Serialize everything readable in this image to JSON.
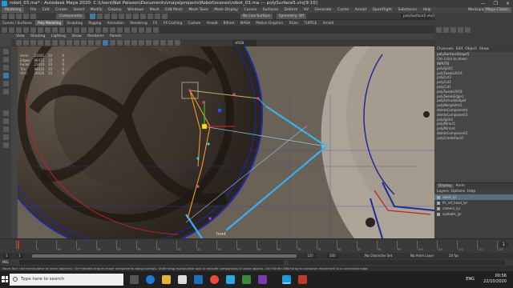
{
  "window": {
    "title": "robot_03.ma* - Autodesk Maya 2020: C:\\Users\\Nat Palazon\\Documents\\maya\\projects\\Robot\\scenes\\robot_03.ma --- polySurface5.vtx[9:10]",
    "controls": [
      "—",
      "❐",
      "✕"
    ]
  },
  "menubar": {
    "workspace": "Modeling",
    "items": [
      "File",
      "Edit",
      "Create",
      "Select",
      "Modify",
      "Display",
      "Windows",
      "Mesh",
      "Edit Mesh",
      "Mesh Tools",
      "Mesh Display",
      "Curves",
      "Surfaces",
      "Deform",
      "UV",
      "Generate",
      "Cache",
      "Arnold",
      "OpenFlight",
      "Substance",
      "Help"
    ],
    "workspace_label": "Workspace:",
    "workspace_value": "Maya Classic"
  },
  "statusline": {
    "mode": "Components",
    "live_surface": "No Live Surface",
    "symmetry": "Symmetry: Off",
    "object_name": "polySurface5.vtx[9:10]"
  },
  "shelf": {
    "tabs": [
      "Curves / Surfaces",
      "Poly Modeling",
      "Sculpting",
      "Rigging",
      "Animation",
      "Rendering",
      "FX",
      "FX Caching",
      "Custom",
      "Arnold",
      "Bifrost",
      "MASH",
      "Motion Graphics",
      "XGen",
      "TURTLE",
      "Arnold"
    ],
    "active_tab": "Poly Modeling"
  },
  "viewport": {
    "menu": [
      "View",
      "Shading",
      "Lighting",
      "Show",
      "Renderer",
      "Panels"
    ],
    "color_space": "sRGB gamma",
    "camera_label": "front",
    "stats": [
      {
        "label": "Verts:",
        "a": "23161",
        "b": "10",
        "c": "0"
      },
      {
        "label": "Edges:",
        "a": "46472",
        "b": "10",
        "c": "0"
      },
      {
        "label": "Faces:",
        "a": "23424",
        "b": "10",
        "c": "0"
      },
      {
        "label": "Tris:",
        "a": "46010",
        "b": "10",
        "c": "0"
      },
      {
        "label": "UVs:",
        "a": "24026",
        "b": "24",
        "c": "0"
      }
    ]
  },
  "channel_box": {
    "tabs": [
      "Channels",
      "Edit",
      "Object",
      "Show"
    ],
    "title": "polySurfaceShape5",
    "subtitle": "CVs (click to show)",
    "inputs_label": "INPUTS",
    "items": [
      "polySplit5",
      "polyTweakUV19",
      "polyCut3",
      "polyCut2",
      "polyCut1",
      "polyTweakUV18",
      "polyTweakEdge1",
      "polyExtrudeEdge4",
      "polyMergeVert1",
      "deleteComponent4",
      "deleteComponent3",
      "polySplit4",
      "polyMirror5",
      "polyMirror4",
      "deleteComponent2",
      "polyCreateFace1"
    ]
  },
  "layers": {
    "header": "Display",
    "tabs": [
      "Display",
      "Anim"
    ],
    "menu": [
      "Layers",
      "Options",
      "Help"
    ],
    "items": [
      {
        "name": "robot_lyr",
        "selected": true
      },
      {
        "name": "lfs_ref_head_lyr",
        "selected": false
      },
      {
        "name": "camera_lyr",
        "selected": false
      },
      {
        "name": "eyeballs_lyr",
        "selected": false
      }
    ]
  },
  "timeline": {
    "ticks": [
      "1",
      "5",
      "10",
      "15",
      "20",
      "25",
      "30",
      "35",
      "40",
      "45",
      "50",
      "55",
      "60",
      "65",
      "70",
      "75",
      "80",
      "85",
      "90",
      "95",
      "100",
      "105",
      "110",
      "115",
      "120"
    ],
    "current_frame": "1",
    "range_start": "1",
    "range_end": "120",
    "anim_end": "200",
    "character_set": "No Character Set",
    "anim_layer": "No Anim Layer",
    "fps": "24 fps"
  },
  "commandline": {
    "lang": "MEL"
  },
  "helpline": {
    "text": "Move Tool: Use manipulator to move object(s). Ctrl+middle-drag to move components along normals. Shift+drag manipulator axis to extrude components or clone objects. Ctrl+Shift+LMB+drag to constrain movement to a connected edge."
  },
  "taskbar": {
    "search_placeholder": "Type here to search",
    "lang": "ENG",
    "time": "00:56",
    "date": "22/10/2020"
  },
  "colors": {
    "accent": "#1b9bd7",
    "selection_orange": "#f0a020",
    "edge_blue": "#3bb0f0",
    "mesh_blue": "#1e2a9a",
    "mesh_red": "#c0202a"
  }
}
